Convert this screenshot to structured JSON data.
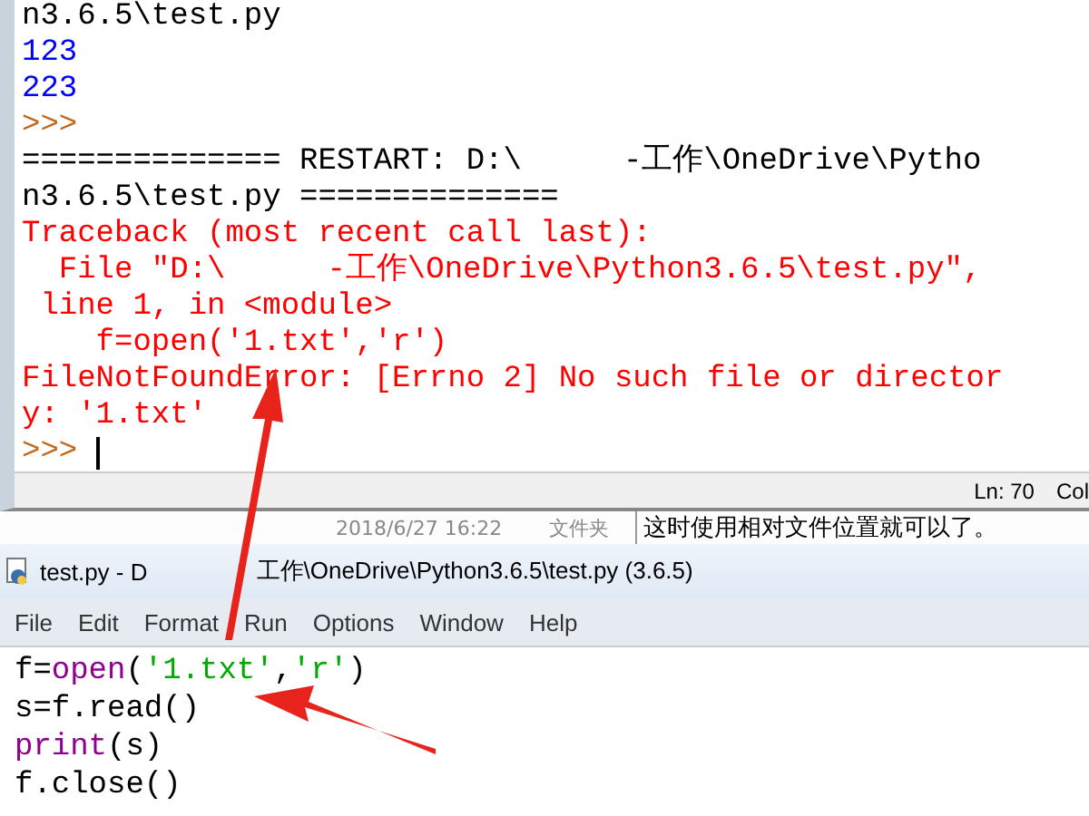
{
  "shell": {
    "lines": [
      {
        "kind": "plain",
        "parts": [
          "n3.6.5\\test.py"
        ]
      },
      {
        "kind": "output",
        "parts": [
          "123"
        ]
      },
      {
        "kind": "output",
        "parts": [
          "223"
        ]
      },
      {
        "kind": "prompt",
        "parts": [
          ">>>"
        ]
      },
      {
        "kind": "plain",
        "parts": [
          "============== RESTART: D:\\",
          "-工作\\OneDrive\\Pytho"
        ]
      },
      {
        "kind": "plain",
        "parts": [
          "n3.6.5\\test.py =============="
        ]
      },
      {
        "kind": "error",
        "parts": [
          "Traceback (most recent call last):"
        ]
      },
      {
        "kind": "error",
        "parts": [
          "  File \"D:\\",
          "-工作\\OneDrive\\Python3.6.5\\test.py\","
        ]
      },
      {
        "kind": "error",
        "parts": [
          " line 1, in <module>"
        ]
      },
      {
        "kind": "error",
        "parts": [
          "    f=open('1.txt','r')"
        ]
      },
      {
        "kind": "error",
        "parts": [
          "FileNotFoundError: [Errno 2] No such file or director"
        ]
      },
      {
        "kind": "error",
        "parts": [
          "y: '1.txt'"
        ]
      },
      {
        "kind": "prompt",
        "parts": [
          ">>>"
        ],
        "cursor": true
      }
    ],
    "status_bar": [
      "Ln: 70",
      "Col"
    ]
  },
  "background": {
    "date": "2018/6/27 16:22",
    "type": "文件夹",
    "note": "这时使用相对文件位置就可以了。"
  },
  "editor": {
    "title": [
      "test.py - D",
      "工作\\OneDrive\\Python3.6.5\\test.py (3.6.5)"
    ],
    "menu": [
      "File",
      "Edit",
      "Format",
      "Run",
      "Options",
      "Window",
      "Help"
    ],
    "code": [
      [
        {
          "kind": "plain",
          "text": "f="
        },
        {
          "kind": "builtin",
          "text": "open"
        },
        {
          "kind": "plain",
          "text": "("
        },
        {
          "kind": "string",
          "text": "'1.txt'"
        },
        {
          "kind": "plain",
          "text": ","
        },
        {
          "kind": "string",
          "text": "'r'"
        },
        {
          "kind": "plain",
          "text": ")"
        }
      ],
      [
        {
          "kind": "plain",
          "text": "s=f.read()"
        }
      ],
      [
        {
          "kind": "builtin",
          "text": "print"
        },
        {
          "kind": "plain",
          "text": "(s)"
        }
      ],
      [
        {
          "kind": "plain",
          "text": "f.close()"
        }
      ]
    ]
  }
}
